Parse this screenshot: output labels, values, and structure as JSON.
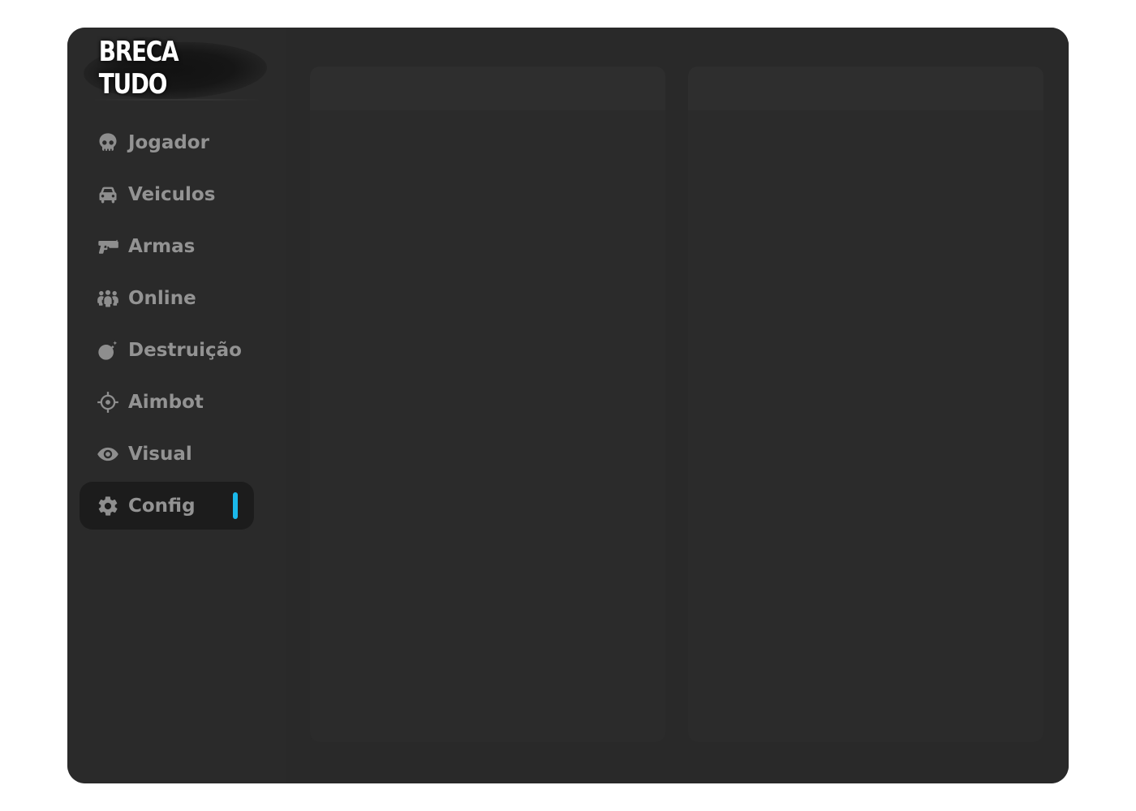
{
  "app": {
    "title": "BRECA TUDO"
  },
  "colors": {
    "accent": "#1ab8ea",
    "window_bg": "#272727",
    "sidebar_bg": "#2a2a2a",
    "active_item_bg": "#1c1c1c",
    "text_muted": "#939393"
  },
  "sidebar": {
    "items": [
      {
        "label": "Jogador",
        "icon": "skull-icon",
        "active": false
      },
      {
        "label": "Veiculos",
        "icon": "car-icon",
        "active": false
      },
      {
        "label": "Armas",
        "icon": "gun-icon",
        "active": false
      },
      {
        "label": "Online",
        "icon": "users-icon",
        "active": false
      },
      {
        "label": "Destruição",
        "icon": "bomb-icon",
        "active": false
      },
      {
        "label": "Aimbot",
        "icon": "crosshair-icon",
        "active": false
      },
      {
        "label": "Visual",
        "icon": "eye-icon",
        "active": false
      },
      {
        "label": "Config",
        "icon": "gear-icon",
        "active": true
      }
    ]
  }
}
